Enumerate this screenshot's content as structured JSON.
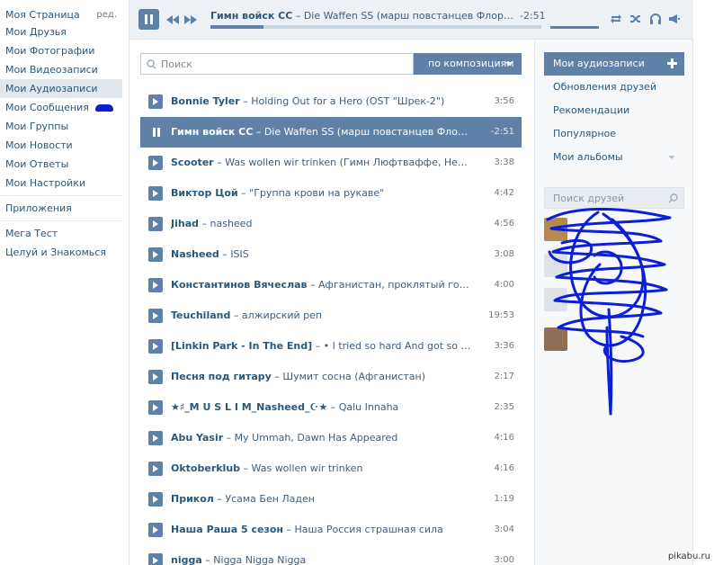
{
  "left_nav": {
    "items": [
      {
        "label": "Моя Страница",
        "edit": "ред."
      },
      {
        "label": "Мои Друзья"
      },
      {
        "label": "Мои Фотографии"
      },
      {
        "label": "Мои Видеозаписи"
      },
      {
        "label": "Мои Аудиозаписи",
        "active": true
      },
      {
        "label": "Мои Сообщения"
      },
      {
        "label": "Мои Группы"
      },
      {
        "label": "Мои Новости"
      },
      {
        "label": "Мои Ответы"
      },
      {
        "label": "Мои Настройки"
      },
      {
        "label": "Приложения"
      },
      {
        "label": "Мега Тест"
      },
      {
        "label": "Целуй и Знакомься"
      }
    ]
  },
  "player": {
    "artist": "Гимн войск СС",
    "title": "Die Waffen SS (марш повстанцев Флориана ...",
    "time": "-2:51",
    "progress": 0.16
  },
  "search": {
    "placeholder": "Поиск",
    "filter_label": "по композициям"
  },
  "tracks": [
    {
      "artist": "Bonnie Tyler",
      "title": "Holding Out for a Hero (OST \"Шрек-2\")",
      "duration": "3:56"
    },
    {
      "artist": "Гимн войск СС",
      "title": "Die Waffen SS (марш повстанцев Флориана ...",
      "duration": "-2:51",
      "current": true
    },
    {
      "artist": "Scooter",
      "title": "Was wollen wir trinken (Гимн Люфтваффе, Немецкий...",
      "duration": "3:38"
    },
    {
      "artist": "Виктор Цой",
      "title": "\"Группа крови на рукаве\"",
      "duration": "4:42"
    },
    {
      "artist": "Jihad",
      "title": "nasheed",
      "duration": "4:56"
    },
    {
      "artist": "Nasheed",
      "title": "ISIS",
      "duration": "3:08"
    },
    {
      "artist": "Константинов Вячеслав",
      "title": "Афганистан, проклятый горный ...",
      "duration": "4:00"
    },
    {
      "artist": "Teuchiland",
      "title": "алжирский реп",
      "duration": "19:53"
    },
    {
      "artist": "[Linkin Park - In The End]",
      "title": "• I tried so hard And got so far Bu...",
      "duration": "3:36"
    },
    {
      "artist": "Песня под гитару",
      "title": "Шумит сосна (Афганистан)",
      "duration": "2:17"
    },
    {
      "artist": "★♯_M U S L I M_Nasheed_☪★",
      "title": "Qalu Innaha",
      "duration": "2:35"
    },
    {
      "artist": "Abu Yasir",
      "title": "My Ummah, Dawn Has Appeared",
      "duration": "4:16"
    },
    {
      "artist": "Oktoberklub",
      "title": "Was wollen wir trinken",
      "duration": "4:16"
    },
    {
      "artist": "Прикол",
      "title": "Усама Бен Ладен",
      "duration": "1:19"
    },
    {
      "artist": "Наша Раша 5 сезон",
      "title": "Наша Россия страшная сила",
      "duration": "3:04"
    },
    {
      "artist": "nigga",
      "title": "Nigga Nigga Nigga",
      "duration": "3:00"
    }
  ],
  "right_panel": {
    "items": [
      {
        "label": "Мои аудиозаписи",
        "active": true
      },
      {
        "label": "Обновления друзей"
      },
      {
        "label": "Рекомендации"
      },
      {
        "label": "Популярное"
      },
      {
        "label": "Мои альбомы"
      }
    ],
    "friends_search_placeholder": "Поиск друзей"
  },
  "colors": {
    "accent": "#5e81a8",
    "link": "#2b587a",
    "scribble": "#0a1fd6"
  },
  "watermark": "pikabu.ru"
}
